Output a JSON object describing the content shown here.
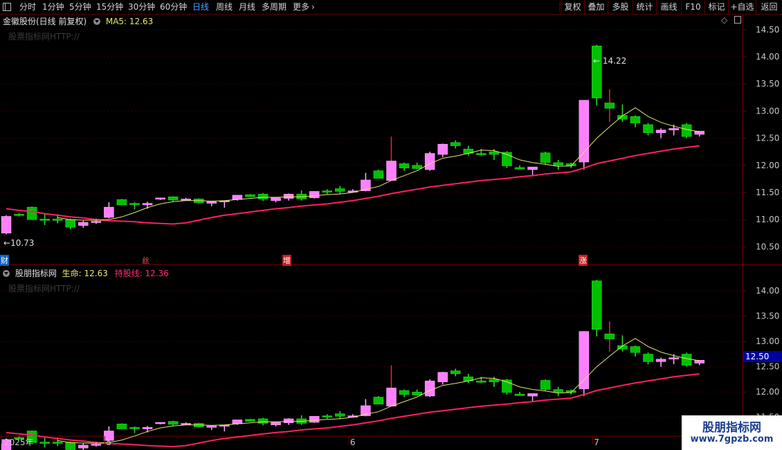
{
  "toolbar": {
    "periods": [
      "分时",
      "1分钟",
      "5分钟",
      "15分钟",
      "30分钟",
      "60分钟",
      "日线",
      "周线",
      "月线",
      "多周期",
      "更多"
    ],
    "selected": "日线",
    "more_arrow": "›",
    "buttons": [
      "复权",
      "叠加",
      "多股",
      "统计",
      "画线",
      "F10",
      "标记",
      "+自选",
      "返回"
    ]
  },
  "upper": {
    "title": "金徽股份(日线 前复权)",
    "ma_label": "MA5: 12.63",
    "watermark": "股票指标网HTTP://",
    "high_label": "14.22",
    "low_label": "10.73",
    "events": [
      "财",
      "丝",
      "增",
      "涨"
    ],
    "axis": [
      "14.50",
      "14.00",
      "13.50",
      "13.00",
      "12.50",
      "12.00",
      "11.50",
      "11.00",
      "10.50"
    ]
  },
  "lower": {
    "title": "股朋指标网",
    "line1_label": "生命: 12.63",
    "line2_label": "持股线: 12.36",
    "watermark": "股票指标网HTTP://",
    "axis": [
      "14.00",
      "13.50",
      "13.00",
      "12.50",
      "12.00",
      "11.50"
    ],
    "price_tag": "12.50"
  },
  "dates": [
    "2025年",
    "5",
    "6",
    "7"
  ],
  "logo": {
    "line1": "股朋指标网",
    "line2": "www.7gpzb.com"
  },
  "colors": {
    "up": "#ff80ff",
    "up_edge": "#ffb0ff",
    "down": "#00c000",
    "down_edge": "#30e030",
    "ma": "#e8e870",
    "hold": "#ff2060",
    "grid": "#330000",
    "frame": "#7a0000",
    "axis_text": "#c8c8c8",
    "tag_bg": "#0000a0"
  },
  "chart_data": {
    "type": "candlestick",
    "title": "金徽股份(日线 前复权)",
    "candles": [
      {
        "o": 10.75,
        "h": 11.08,
        "l": 10.73,
        "c": 11.06
      },
      {
        "o": 11.1,
        "h": 11.12,
        "l": 11.06,
        "c": 11.08
      },
      {
        "o": 11.23,
        "h": 11.24,
        "l": 11.0,
        "c": 11.0
      },
      {
        "o": 11.01,
        "h": 11.12,
        "l": 10.9,
        "c": 10.99
      },
      {
        "o": 11.01,
        "h": 11.1,
        "l": 10.93,
        "c": 11.0
      },
      {
        "o": 11.0,
        "h": 11.02,
        "l": 10.82,
        "c": 10.86
      },
      {
        "o": 10.89,
        "h": 10.98,
        "l": 10.85,
        "c": 10.95
      },
      {
        "o": 10.95,
        "h": 11.02,
        "l": 10.92,
        "c": 10.97
      },
      {
        "o": 11.04,
        "h": 11.32,
        "l": 11.02,
        "c": 11.23
      },
      {
        "o": 11.37,
        "h": 11.38,
        "l": 11.27,
        "c": 11.27
      },
      {
        "o": 11.3,
        "h": 11.32,
        "l": 11.19,
        "c": 11.28
      },
      {
        "o": 11.27,
        "h": 11.33,
        "l": 11.2,
        "c": 11.3
      },
      {
        "o": 11.38,
        "h": 11.4,
        "l": 11.36,
        "c": 11.4
      },
      {
        "o": 11.42,
        "h": 11.43,
        "l": 11.34,
        "c": 11.36
      },
      {
        "o": 11.38,
        "h": 11.4,
        "l": 11.37,
        "c": 11.38
      },
      {
        "o": 11.38,
        "h": 11.39,
        "l": 11.3,
        "c": 11.31
      },
      {
        "o": 11.3,
        "h": 11.33,
        "l": 11.25,
        "c": 11.33
      },
      {
        "o": 11.33,
        "h": 11.35,
        "l": 11.22,
        "c": 11.35
      },
      {
        "o": 11.37,
        "h": 11.45,
        "l": 11.35,
        "c": 11.45
      },
      {
        "o": 11.46,
        "h": 11.47,
        "l": 11.42,
        "c": 11.42
      },
      {
        "o": 11.47,
        "h": 11.49,
        "l": 11.34,
        "c": 11.38
      },
      {
        "o": 11.35,
        "h": 11.4,
        "l": 11.32,
        "c": 11.4
      },
      {
        "o": 11.39,
        "h": 11.48,
        "l": 11.35,
        "c": 11.47
      },
      {
        "o": 11.47,
        "h": 11.54,
        "l": 11.35,
        "c": 11.38
      },
      {
        "o": 11.4,
        "h": 11.52,
        "l": 11.39,
        "c": 11.52
      },
      {
        "o": 11.53,
        "h": 11.56,
        "l": 11.47,
        "c": 11.51
      },
      {
        "o": 11.57,
        "h": 11.62,
        "l": 11.47,
        "c": 11.52
      },
      {
        "o": 11.53,
        "h": 11.56,
        "l": 11.5,
        "c": 11.53
      },
      {
        "o": 11.53,
        "h": 11.86,
        "l": 11.52,
        "c": 11.73
      },
      {
        "o": 11.9,
        "h": 11.92,
        "l": 11.78,
        "c": 11.76
      },
      {
        "o": 11.72,
        "h": 12.53,
        "l": 11.72,
        "c": 12.08
      },
      {
        "o": 12.03,
        "h": 12.05,
        "l": 11.9,
        "c": 11.95
      },
      {
        "o": 12.0,
        "h": 12.05,
        "l": 11.93,
        "c": 11.94
      },
      {
        "o": 11.92,
        "h": 12.25,
        "l": 11.9,
        "c": 12.22
      },
      {
        "o": 12.2,
        "h": 12.4,
        "l": 12.15,
        "c": 12.39
      },
      {
        "o": 12.42,
        "h": 12.46,
        "l": 12.31,
        "c": 12.36
      },
      {
        "o": 12.3,
        "h": 12.36,
        "l": 12.18,
        "c": 12.22
      },
      {
        "o": 12.22,
        "h": 12.3,
        "l": 12.18,
        "c": 12.21
      },
      {
        "o": 12.25,
        "h": 12.3,
        "l": 12.1,
        "c": 12.2
      },
      {
        "o": 12.24,
        "h": 12.26,
        "l": 11.95,
        "c": 11.99
      },
      {
        "o": 11.96,
        "h": 12.0,
        "l": 11.93,
        "c": 11.93
      },
      {
        "o": 11.92,
        "h": 11.97,
        "l": 11.82,
        "c": 11.97
      },
      {
        "o": 12.23,
        "h": 12.25,
        "l": 12.02,
        "c": 12.05
      },
      {
        "o": 12.05,
        "h": 12.1,
        "l": 11.92,
        "c": 12.0
      },
      {
        "o": 12.03,
        "h": 12.05,
        "l": 11.95,
        "c": 11.99
      },
      {
        "o": 12.06,
        "h": 13.2,
        "l": 11.92,
        "c": 13.2
      },
      {
        "o": 14.2,
        "h": 14.22,
        "l": 13.1,
        "c": 13.24
      },
      {
        "o": 13.15,
        "h": 13.4,
        "l": 12.8,
        "c": 13.05
      },
      {
        "o": 12.92,
        "h": 13.12,
        "l": 12.8,
        "c": 12.85
      },
      {
        "o": 12.9,
        "h": 12.92,
        "l": 12.7,
        "c": 12.78
      },
      {
        "o": 12.75,
        "h": 12.78,
        "l": 12.55,
        "c": 12.6
      },
      {
        "o": 12.6,
        "h": 12.68,
        "l": 12.5,
        "c": 12.65
      },
      {
        "o": 12.65,
        "h": 12.75,
        "l": 12.55,
        "c": 12.68
      },
      {
        "o": 12.75,
        "h": 12.78,
        "l": 12.5,
        "c": 12.53
      },
      {
        "o": 12.57,
        "h": 12.63,
        "l": 12.53,
        "c": 12.63
      }
    ],
    "ma5": [
      null,
      null,
      null,
      null,
      11.04,
      11.0,
      10.99,
      10.99,
      11.0,
      11.05,
      11.13,
      11.22,
      11.29,
      11.33,
      11.35,
      11.35,
      11.34,
      11.35,
      11.37,
      11.39,
      11.41,
      11.41,
      11.42,
      11.42,
      11.44,
      11.46,
      11.47,
      11.5,
      11.56,
      11.61,
      11.72,
      11.81,
      11.9,
      12.03,
      12.13,
      12.17,
      12.22,
      12.28,
      12.27,
      12.2,
      12.1,
      12.05,
      12.02,
      11.98,
      11.99,
      12.24,
      12.5,
      12.71,
      12.91,
      13.06,
      12.9,
      12.79,
      12.72,
      12.66,
      12.62
    ],
    "hold_line": [
      11.2,
      11.17,
      11.15,
      11.11,
      11.08,
      11.05,
      11.03,
      11.0,
      10.98,
      10.97,
      10.96,
      10.94,
      10.93,
      10.92,
      10.94,
      10.99,
      11.04,
      11.08,
      11.11,
      11.14,
      11.17,
      11.2,
      11.22,
      11.25,
      11.27,
      11.29,
      11.32,
      11.35,
      11.39,
      11.43,
      11.48,
      11.52,
      11.56,
      11.6,
      11.63,
      11.66,
      11.69,
      11.72,
      11.74,
      11.76,
      11.79,
      11.81,
      11.84,
      11.86,
      11.88,
      11.95,
      12.03,
      12.08,
      12.13,
      12.18,
      12.22,
      12.26,
      12.3,
      12.33,
      12.36
    ],
    "ylim_upper": [
      10.25,
      14.65
    ],
    "ylim_lower": [
      11.25,
      14.4
    ]
  }
}
